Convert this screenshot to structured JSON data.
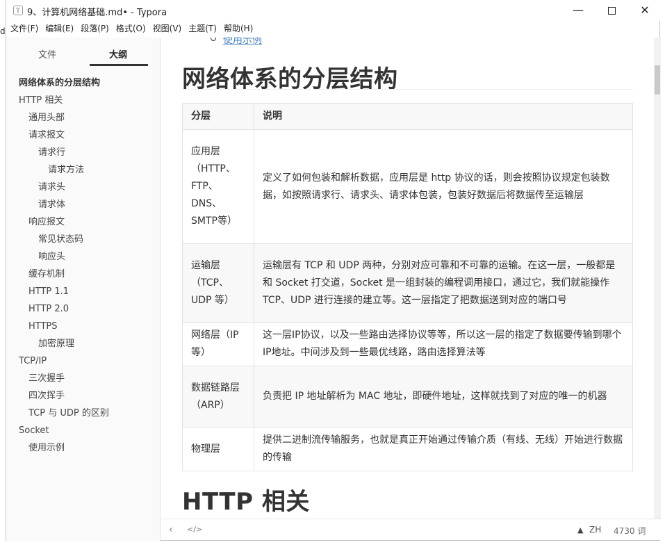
{
  "window": {
    "title": "9、计算机网络基础.md• - Typora",
    "app_icon": "T",
    "minimize_label": "—",
    "close_label": "✕"
  },
  "left_clip_text": "d",
  "menu": [
    "文件(F)",
    "编辑(E)",
    "段落(P)",
    "格式(O)",
    "视图(V)",
    "主题(T)",
    "帮助(H)"
  ],
  "sidebar": {
    "tabs": [
      "文件",
      "大纲"
    ],
    "outline": [
      {
        "label": "网络体系的分层结构",
        "level": 0,
        "active": true
      },
      {
        "label": "HTTP 相关",
        "level": 0
      },
      {
        "label": "通用头部",
        "level": 1
      },
      {
        "label": "请求报文",
        "level": 1
      },
      {
        "label": "请求行",
        "level": 2
      },
      {
        "label": "请求方法",
        "level": 3
      },
      {
        "label": "请求头",
        "level": 2
      },
      {
        "label": "请求体",
        "level": 2
      },
      {
        "label": "响应报文",
        "level": 1
      },
      {
        "label": "常见状态码",
        "level": 2
      },
      {
        "label": "响应头",
        "level": 2
      },
      {
        "label": "缓存机制",
        "level": 1
      },
      {
        "label": "HTTP 1.1",
        "level": 1
      },
      {
        "label": "HTTP 2.0",
        "level": 1
      },
      {
        "label": "HTTPS",
        "level": 1
      },
      {
        "label": "加密原理",
        "level": 2
      },
      {
        "label": "TCP/IP",
        "level": 0
      },
      {
        "label": "三次握手",
        "level": 1
      },
      {
        "label": "四次挥手",
        "level": 1
      },
      {
        "label": "TCP 与 UDP 的区别",
        "level": 1
      },
      {
        "label": "Socket",
        "level": 0
      },
      {
        "label": "使用示例",
        "level": 1
      }
    ]
  },
  "editor": {
    "top_link": "使用示例",
    "heading1": "网络体系的分层结构",
    "heading2": "HTTP 相关",
    "table": {
      "headers": [
        "分层",
        "说明"
      ],
      "rows": [
        [
          "应用层（HTTP、FTP、DNS、SMTP等）",
          "定义了如何包装和解析数据，应用层是 http 协议的话，则会按照协议规定包装数据，如按照请求行、请求头、请求体包装，包装好数据后将数据传至运输层"
        ],
        [
          "运输层（TCP、UDP 等）",
          "运输层有 TCP 和 UDP 两种，分别对应可靠和不可靠的运输。在这一层，一般都是和 Socket 打交道，Socket 是一组封装的编程调用接口，通过它，我们就能操作 TCP、UDP 进行连接的建立等。这一层指定了把数据送到对应的端口号"
        ],
        [
          "网络层（IP 等）",
          "这一层IP协议，以及一些路由选择协议等等，所以这一层的指定了数据要传输到哪个IP地址。中间涉及到一些最优线路，路由选择算法等"
        ],
        [
          "数据链路层（ARP）",
          "负责把 IP 地址解析为 MAC 地址，即硬件地址，这样就找到了对应的唯一的机器"
        ],
        [
          "物理层",
          "提供二进制流传输服务，也就是真正开始通过传输介质（有线、无线）开始进行数据的传输"
        ]
      ]
    }
  },
  "statusbar": {
    "back": "‹",
    "code_toggle": "</>",
    "warning": "▲",
    "lang": "ZH",
    "word_count": "4730 词"
  }
}
